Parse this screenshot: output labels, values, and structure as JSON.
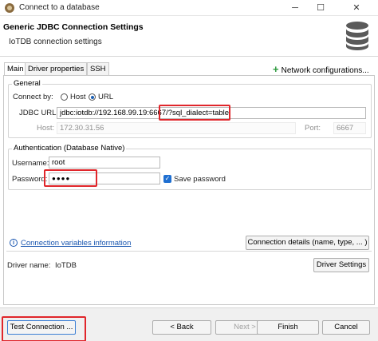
{
  "window": {
    "title": "Connect to a database",
    "minimize": "─",
    "maximize": "☐",
    "close": "✕"
  },
  "header": {
    "title": "Generic JDBC Connection Settings",
    "subtitle": "IoTDB connection settings",
    "icon": "database-icon"
  },
  "tabs": [
    {
      "label": "Main",
      "active": true
    },
    {
      "label": "Driver properties",
      "active": false
    },
    {
      "label": "SSH",
      "active": false
    }
  ],
  "network_config": {
    "icon": "plus-icon",
    "label": "Network configurations..."
  },
  "general": {
    "group_label": "General",
    "connect_by_label": "Connect by:",
    "options": [
      {
        "label": "Host",
        "selected": false
      },
      {
        "label": "URL",
        "selected": true
      }
    ],
    "jdbc_url_label": "JDBC URL:",
    "jdbc_url_value": "jdbc:iotdb://192.168.99.19:6667/?sql_dialect=table",
    "host_label": "Host:",
    "host_value": "172.30.31.56",
    "port_label": "Port:",
    "port_value": "6667"
  },
  "auth": {
    "group_label": "Authentication (Database Native)",
    "username_label": "Username:",
    "username_value": "root",
    "password_label": "Password:",
    "password_value": "●●●●",
    "save_password_label": "Save password",
    "save_password_checked": true,
    "check_glyph": "✓"
  },
  "links": {
    "info_glyph": "i",
    "conn_vars_label": "Connection variables information",
    "conn_details_label": "Connection details (name, type, ... )"
  },
  "driver": {
    "name_label": "Driver name:",
    "name_value": "IoTDB",
    "settings_label": "Driver Settings"
  },
  "footer": {
    "test_label": "Test Connection ...",
    "back_label": "< Back",
    "next_label": "Next >",
    "finish_label": "Finish",
    "cancel_label": "Cancel"
  },
  "colors": {
    "highlight": "#e0262b",
    "link": "#1a57b0",
    "accent": "#1f6fd1",
    "add": "#2e9a3e"
  }
}
